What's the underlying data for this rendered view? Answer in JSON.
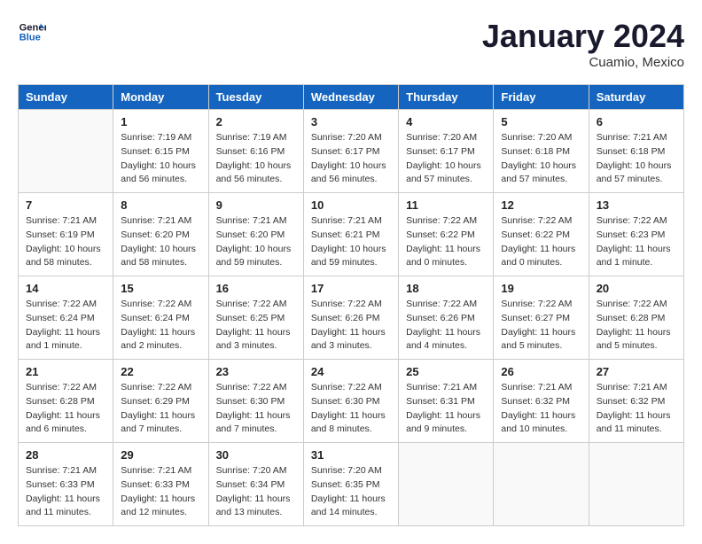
{
  "header": {
    "logo_line1": "General",
    "logo_line2": "Blue",
    "month": "January 2024",
    "location": "Cuamio, Mexico"
  },
  "columns": [
    "Sunday",
    "Monday",
    "Tuesday",
    "Wednesday",
    "Thursday",
    "Friday",
    "Saturday"
  ],
  "weeks": [
    [
      {
        "day": "",
        "info": ""
      },
      {
        "day": "1",
        "info": "Sunrise: 7:19 AM\nSunset: 6:15 PM\nDaylight: 10 hours\nand 56 minutes."
      },
      {
        "day": "2",
        "info": "Sunrise: 7:19 AM\nSunset: 6:16 PM\nDaylight: 10 hours\nand 56 minutes."
      },
      {
        "day": "3",
        "info": "Sunrise: 7:20 AM\nSunset: 6:17 PM\nDaylight: 10 hours\nand 56 minutes."
      },
      {
        "day": "4",
        "info": "Sunrise: 7:20 AM\nSunset: 6:17 PM\nDaylight: 10 hours\nand 57 minutes."
      },
      {
        "day": "5",
        "info": "Sunrise: 7:20 AM\nSunset: 6:18 PM\nDaylight: 10 hours\nand 57 minutes."
      },
      {
        "day": "6",
        "info": "Sunrise: 7:21 AM\nSunset: 6:18 PM\nDaylight: 10 hours\nand 57 minutes."
      }
    ],
    [
      {
        "day": "7",
        "info": "Sunrise: 7:21 AM\nSunset: 6:19 PM\nDaylight: 10 hours\nand 58 minutes."
      },
      {
        "day": "8",
        "info": "Sunrise: 7:21 AM\nSunset: 6:20 PM\nDaylight: 10 hours\nand 58 minutes."
      },
      {
        "day": "9",
        "info": "Sunrise: 7:21 AM\nSunset: 6:20 PM\nDaylight: 10 hours\nand 59 minutes."
      },
      {
        "day": "10",
        "info": "Sunrise: 7:21 AM\nSunset: 6:21 PM\nDaylight: 10 hours\nand 59 minutes."
      },
      {
        "day": "11",
        "info": "Sunrise: 7:22 AM\nSunset: 6:22 PM\nDaylight: 11 hours\nand 0 minutes."
      },
      {
        "day": "12",
        "info": "Sunrise: 7:22 AM\nSunset: 6:22 PM\nDaylight: 11 hours\nand 0 minutes."
      },
      {
        "day": "13",
        "info": "Sunrise: 7:22 AM\nSunset: 6:23 PM\nDaylight: 11 hours\nand 1 minute."
      }
    ],
    [
      {
        "day": "14",
        "info": "Sunrise: 7:22 AM\nSunset: 6:24 PM\nDaylight: 11 hours\nand 1 minute."
      },
      {
        "day": "15",
        "info": "Sunrise: 7:22 AM\nSunset: 6:24 PM\nDaylight: 11 hours\nand 2 minutes."
      },
      {
        "day": "16",
        "info": "Sunrise: 7:22 AM\nSunset: 6:25 PM\nDaylight: 11 hours\nand 3 minutes."
      },
      {
        "day": "17",
        "info": "Sunrise: 7:22 AM\nSunset: 6:26 PM\nDaylight: 11 hours\nand 3 minutes."
      },
      {
        "day": "18",
        "info": "Sunrise: 7:22 AM\nSunset: 6:26 PM\nDaylight: 11 hours\nand 4 minutes."
      },
      {
        "day": "19",
        "info": "Sunrise: 7:22 AM\nSunset: 6:27 PM\nDaylight: 11 hours\nand 5 minutes."
      },
      {
        "day": "20",
        "info": "Sunrise: 7:22 AM\nSunset: 6:28 PM\nDaylight: 11 hours\nand 5 minutes."
      }
    ],
    [
      {
        "day": "21",
        "info": "Sunrise: 7:22 AM\nSunset: 6:28 PM\nDaylight: 11 hours\nand 6 minutes."
      },
      {
        "day": "22",
        "info": "Sunrise: 7:22 AM\nSunset: 6:29 PM\nDaylight: 11 hours\nand 7 minutes."
      },
      {
        "day": "23",
        "info": "Sunrise: 7:22 AM\nSunset: 6:30 PM\nDaylight: 11 hours\nand 7 minutes."
      },
      {
        "day": "24",
        "info": "Sunrise: 7:22 AM\nSunset: 6:30 PM\nDaylight: 11 hours\nand 8 minutes."
      },
      {
        "day": "25",
        "info": "Sunrise: 7:21 AM\nSunset: 6:31 PM\nDaylight: 11 hours\nand 9 minutes."
      },
      {
        "day": "26",
        "info": "Sunrise: 7:21 AM\nSunset: 6:32 PM\nDaylight: 11 hours\nand 10 minutes."
      },
      {
        "day": "27",
        "info": "Sunrise: 7:21 AM\nSunset: 6:32 PM\nDaylight: 11 hours\nand 11 minutes."
      }
    ],
    [
      {
        "day": "28",
        "info": "Sunrise: 7:21 AM\nSunset: 6:33 PM\nDaylight: 11 hours\nand 11 minutes."
      },
      {
        "day": "29",
        "info": "Sunrise: 7:21 AM\nSunset: 6:33 PM\nDaylight: 11 hours\nand 12 minutes."
      },
      {
        "day": "30",
        "info": "Sunrise: 7:20 AM\nSunset: 6:34 PM\nDaylight: 11 hours\nand 13 minutes."
      },
      {
        "day": "31",
        "info": "Sunrise: 7:20 AM\nSunset: 6:35 PM\nDaylight: 11 hours\nand 14 minutes."
      },
      {
        "day": "",
        "info": ""
      },
      {
        "day": "",
        "info": ""
      },
      {
        "day": "",
        "info": ""
      }
    ]
  ]
}
